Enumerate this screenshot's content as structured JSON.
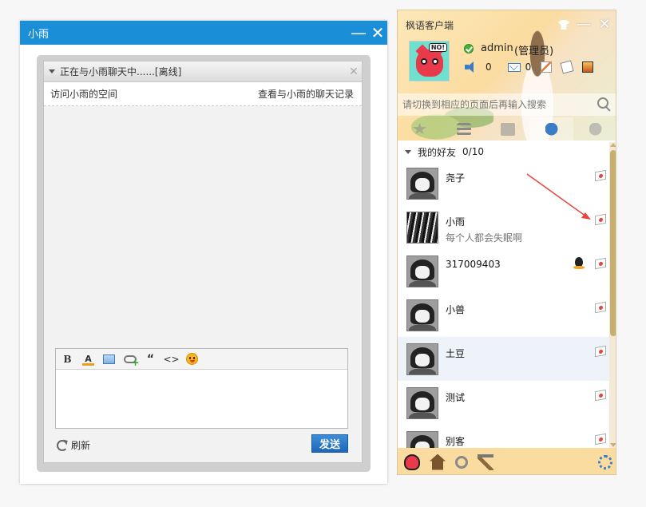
{
  "chat_window": {
    "title": "小雨",
    "header": "正在与小雨聊天中......[离线]",
    "visit_space": "访问小雨的空间",
    "view_history": "查看与小雨的聊天记录",
    "input_value": "",
    "refresh_label": "刷新",
    "send_label": "发送"
  },
  "client": {
    "title": "枫语客户端",
    "user": {
      "name": "admin",
      "role": "(管理员)",
      "sound_count": "0",
      "mail_count": "0"
    },
    "search": {
      "placeholder": "请切换到相应的页面后再输入搜索",
      "value": ""
    },
    "tabs": [
      "star-icon",
      "list-icon",
      "box-icon",
      "user-icon",
      "users-icon"
    ],
    "active_tab": 3,
    "group": {
      "name": "我的好友",
      "count": "0/10"
    },
    "friends": [
      {
        "name": "尧子",
        "signature": ""
      },
      {
        "name": "小雨",
        "signature": "每个人都会失眠啊"
      },
      {
        "name": "317009403",
        "signature": ""
      },
      {
        "name": "小兽",
        "signature": ""
      },
      {
        "name": "土豆",
        "signature": ""
      },
      {
        "name": "测试",
        "signature": ""
      },
      {
        "name": "别客",
        "signature": ""
      }
    ]
  },
  "colors": {
    "chat_titlebar": "#1a8fd8",
    "send_button": "#1e66b8",
    "client_theme": "#fbdca0",
    "annotation_arrow": "#e8453c"
  }
}
